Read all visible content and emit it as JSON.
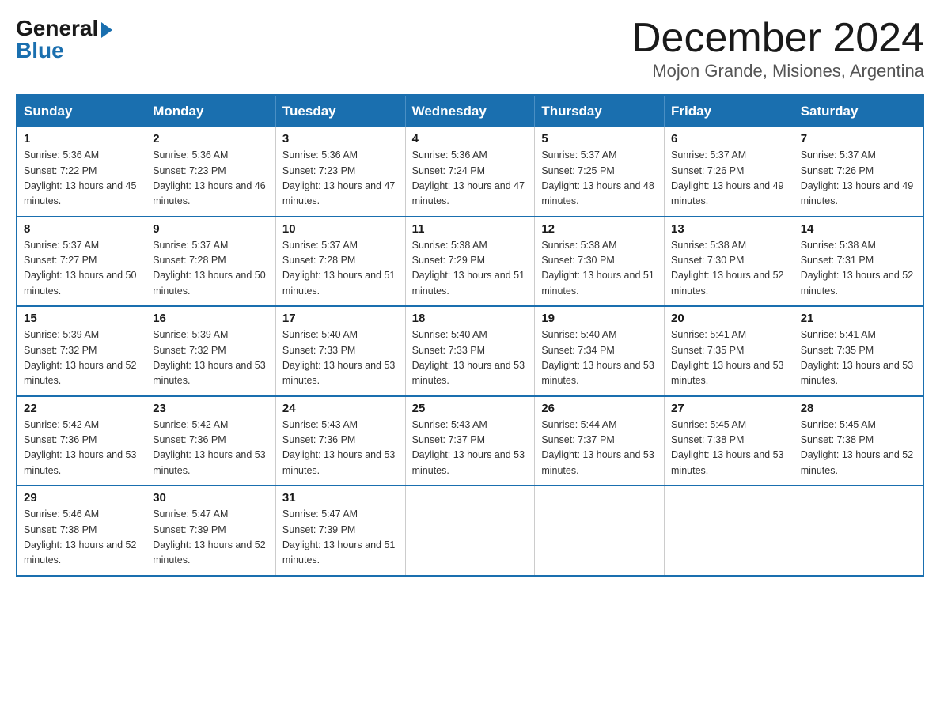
{
  "header": {
    "logo_general": "General",
    "logo_blue": "Blue",
    "month_title": "December 2024",
    "location": "Mojon Grande, Misiones, Argentina"
  },
  "days_of_week": [
    "Sunday",
    "Monday",
    "Tuesday",
    "Wednesday",
    "Thursday",
    "Friday",
    "Saturday"
  ],
  "weeks": [
    [
      {
        "day": "1",
        "sunrise": "5:36 AM",
        "sunset": "7:22 PM",
        "daylight": "13 hours and 45 minutes."
      },
      {
        "day": "2",
        "sunrise": "5:36 AM",
        "sunset": "7:23 PM",
        "daylight": "13 hours and 46 minutes."
      },
      {
        "day": "3",
        "sunrise": "5:36 AM",
        "sunset": "7:23 PM",
        "daylight": "13 hours and 47 minutes."
      },
      {
        "day": "4",
        "sunrise": "5:36 AM",
        "sunset": "7:24 PM",
        "daylight": "13 hours and 47 minutes."
      },
      {
        "day": "5",
        "sunrise": "5:37 AM",
        "sunset": "7:25 PM",
        "daylight": "13 hours and 48 minutes."
      },
      {
        "day": "6",
        "sunrise": "5:37 AM",
        "sunset": "7:26 PM",
        "daylight": "13 hours and 49 minutes."
      },
      {
        "day": "7",
        "sunrise": "5:37 AM",
        "sunset": "7:26 PM",
        "daylight": "13 hours and 49 minutes."
      }
    ],
    [
      {
        "day": "8",
        "sunrise": "5:37 AM",
        "sunset": "7:27 PM",
        "daylight": "13 hours and 50 minutes."
      },
      {
        "day": "9",
        "sunrise": "5:37 AM",
        "sunset": "7:28 PM",
        "daylight": "13 hours and 50 minutes."
      },
      {
        "day": "10",
        "sunrise": "5:37 AM",
        "sunset": "7:28 PM",
        "daylight": "13 hours and 51 minutes."
      },
      {
        "day": "11",
        "sunrise": "5:38 AM",
        "sunset": "7:29 PM",
        "daylight": "13 hours and 51 minutes."
      },
      {
        "day": "12",
        "sunrise": "5:38 AM",
        "sunset": "7:30 PM",
        "daylight": "13 hours and 51 minutes."
      },
      {
        "day": "13",
        "sunrise": "5:38 AM",
        "sunset": "7:30 PM",
        "daylight": "13 hours and 52 minutes."
      },
      {
        "day": "14",
        "sunrise": "5:38 AM",
        "sunset": "7:31 PM",
        "daylight": "13 hours and 52 minutes."
      }
    ],
    [
      {
        "day": "15",
        "sunrise": "5:39 AM",
        "sunset": "7:32 PM",
        "daylight": "13 hours and 52 minutes."
      },
      {
        "day": "16",
        "sunrise": "5:39 AM",
        "sunset": "7:32 PM",
        "daylight": "13 hours and 53 minutes."
      },
      {
        "day": "17",
        "sunrise": "5:40 AM",
        "sunset": "7:33 PM",
        "daylight": "13 hours and 53 minutes."
      },
      {
        "day": "18",
        "sunrise": "5:40 AM",
        "sunset": "7:33 PM",
        "daylight": "13 hours and 53 minutes."
      },
      {
        "day": "19",
        "sunrise": "5:40 AM",
        "sunset": "7:34 PM",
        "daylight": "13 hours and 53 minutes."
      },
      {
        "day": "20",
        "sunrise": "5:41 AM",
        "sunset": "7:35 PM",
        "daylight": "13 hours and 53 minutes."
      },
      {
        "day": "21",
        "sunrise": "5:41 AM",
        "sunset": "7:35 PM",
        "daylight": "13 hours and 53 minutes."
      }
    ],
    [
      {
        "day": "22",
        "sunrise": "5:42 AM",
        "sunset": "7:36 PM",
        "daylight": "13 hours and 53 minutes."
      },
      {
        "day": "23",
        "sunrise": "5:42 AM",
        "sunset": "7:36 PM",
        "daylight": "13 hours and 53 minutes."
      },
      {
        "day": "24",
        "sunrise": "5:43 AM",
        "sunset": "7:36 PM",
        "daylight": "13 hours and 53 minutes."
      },
      {
        "day": "25",
        "sunrise": "5:43 AM",
        "sunset": "7:37 PM",
        "daylight": "13 hours and 53 minutes."
      },
      {
        "day": "26",
        "sunrise": "5:44 AM",
        "sunset": "7:37 PM",
        "daylight": "13 hours and 53 minutes."
      },
      {
        "day": "27",
        "sunrise": "5:45 AM",
        "sunset": "7:38 PM",
        "daylight": "13 hours and 53 minutes."
      },
      {
        "day": "28",
        "sunrise": "5:45 AM",
        "sunset": "7:38 PM",
        "daylight": "13 hours and 52 minutes."
      }
    ],
    [
      {
        "day": "29",
        "sunrise": "5:46 AM",
        "sunset": "7:38 PM",
        "daylight": "13 hours and 52 minutes."
      },
      {
        "day": "30",
        "sunrise": "5:47 AM",
        "sunset": "7:39 PM",
        "daylight": "13 hours and 52 minutes."
      },
      {
        "day": "31",
        "sunrise": "5:47 AM",
        "sunset": "7:39 PM",
        "daylight": "13 hours and 51 minutes."
      },
      null,
      null,
      null,
      null
    ]
  ]
}
